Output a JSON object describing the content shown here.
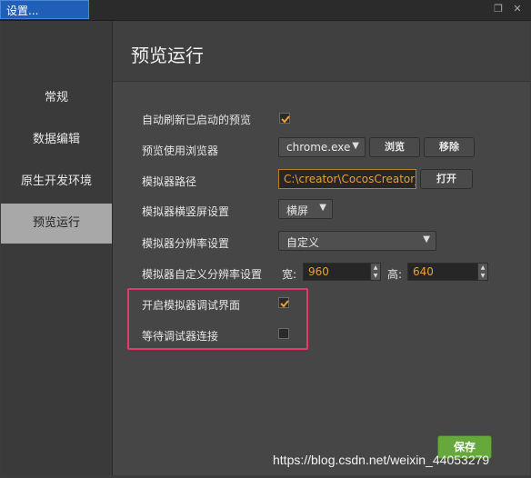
{
  "window": {
    "tab_title": "设置..."
  },
  "sidebar": {
    "items": [
      {
        "label": "常规"
      },
      {
        "label": "数据编辑"
      },
      {
        "label": "原生开发环境"
      },
      {
        "label": "预览运行"
      }
    ],
    "active_index": 3
  },
  "main": {
    "title": "预览运行",
    "settings": {
      "auto_refresh": {
        "label": "自动刷新已启动的预览",
        "checked": true
      },
      "browser": {
        "label": "预览使用浏览器",
        "value": "chrome.exe",
        "browse": "浏览",
        "remove": "移除"
      },
      "sim_path": {
        "label": "模拟器路径",
        "value": "C:\\creator\\CocosCreator_v",
        "open": "打开"
      },
      "orientation": {
        "label": "模拟器横竖屏设置",
        "value": "横屏"
      },
      "resolution": {
        "label": "模拟器分辨率设置",
        "value": "自定义"
      },
      "custom_res": {
        "label": "模拟器自定义分辨率设置",
        "width_label": "宽:",
        "width": "960",
        "height_label": "高:",
        "height": "640"
      },
      "debug_ui": {
        "label": "开启模拟器调试界面",
        "checked": true
      },
      "wait_debugger": {
        "label": "等待调试器连接",
        "checked": false
      }
    },
    "save": "保存"
  },
  "watermark": "https://blog.csdn.net/weixin_44053279",
  "colors": {
    "accent": "#e8a03c",
    "check": "#f0a030",
    "highlight": "#e6396b",
    "save": "#67a83c"
  }
}
